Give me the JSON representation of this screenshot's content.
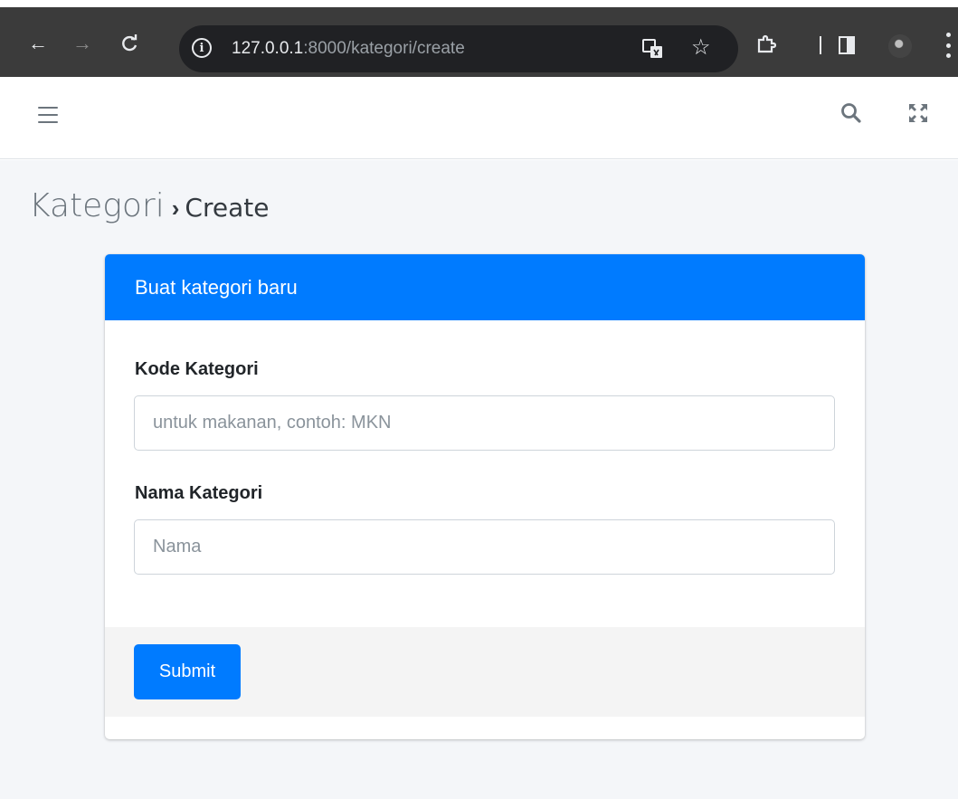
{
  "browser": {
    "url_host": "127.0.0.1",
    "url_rest": ":8000/kategori/create"
  },
  "page": {
    "heading": "Kategori",
    "separator": "›",
    "subheading": "Create"
  },
  "card": {
    "title": "Buat kategori baru",
    "fields": [
      {
        "label": "Kode Kategori",
        "placeholder": "untuk makanan, contoh: MKN",
        "value": ""
      },
      {
        "label": "Nama Kategori",
        "placeholder": "Nama",
        "value": ""
      }
    ],
    "submit_label": "Submit"
  },
  "colors": {
    "primary": "#007bff",
    "content_bg": "#f4f6f9",
    "chrome_bg": "#3b3b3b"
  }
}
